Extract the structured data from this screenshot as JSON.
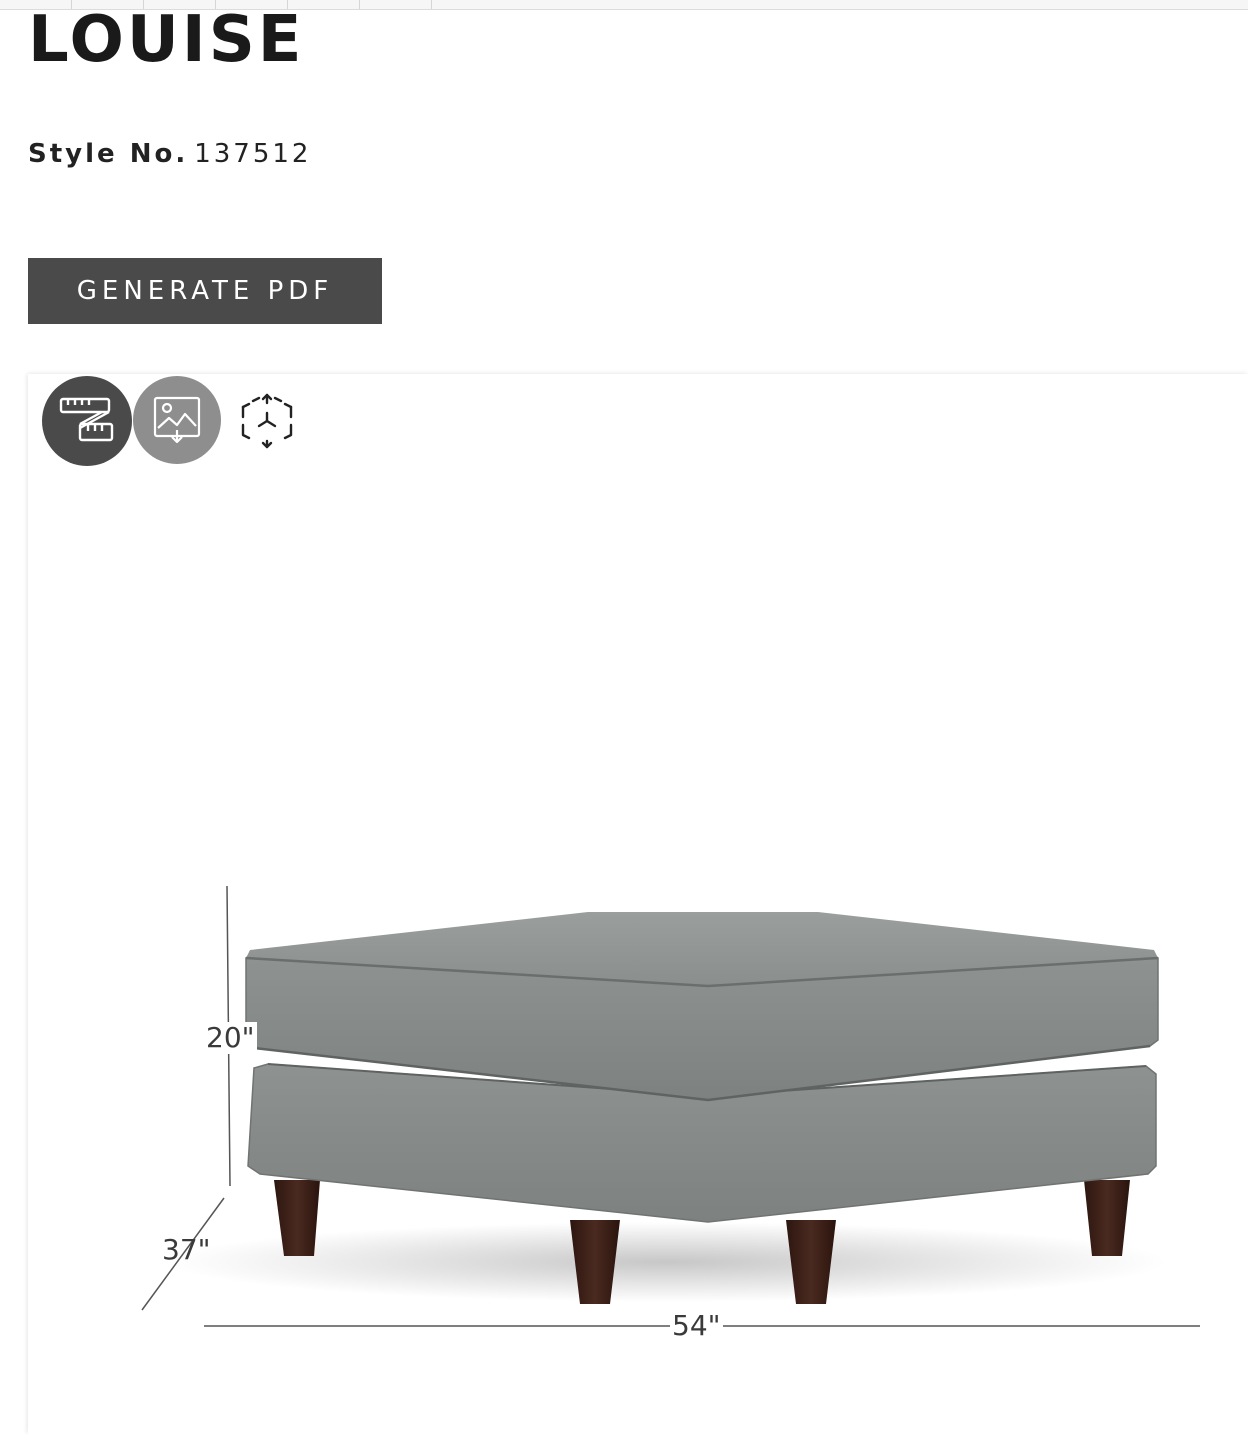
{
  "product": {
    "name": "LOUISE",
    "style_label": "Style No.",
    "style_number": "137512"
  },
  "actions": {
    "generate_pdf_label": "GENERATE PDF"
  },
  "viewer": {
    "buttons": [
      {
        "icon": "tape-measure-icon",
        "state": "active",
        "color": "#4a4a4a"
      },
      {
        "icon": "image-download-icon",
        "state": "inactive",
        "color": "#8e8e8e"
      },
      {
        "icon": "3d-cube-icon",
        "state": "inactive"
      }
    ],
    "dimensions": {
      "height": "20\"",
      "depth": "37\"",
      "width": "54\""
    }
  },
  "colors": {
    "button_dark": "#4a4a4a",
    "button_light": "#8e8e8e",
    "fabric": "#8d918f",
    "legs": "#3b1f17"
  }
}
